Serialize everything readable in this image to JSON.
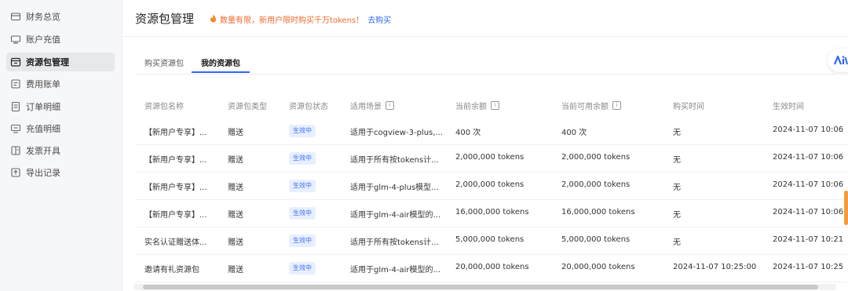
{
  "sidebar": {
    "items": [
      {
        "label": "财务总览",
        "icon": "wallet-icon",
        "active": false
      },
      {
        "label": "账户充值",
        "icon": "card-icon",
        "active": false
      },
      {
        "label": "资源包管理",
        "icon": "package-icon",
        "active": true
      },
      {
        "label": "费用账单",
        "icon": "bill-icon",
        "active": false
      },
      {
        "label": "订单明细",
        "icon": "order-icon",
        "active": false
      },
      {
        "label": "充值明细",
        "icon": "recharge-icon",
        "active": false
      },
      {
        "label": "发票开具",
        "icon": "invoice-icon",
        "active": false
      },
      {
        "label": "导出记录",
        "icon": "export-icon",
        "active": false
      }
    ]
  },
  "header": {
    "title": "资源包管理",
    "notice_text": "数量有限，新用户限时购买千万tokens！",
    "notice_link": "去购买",
    "notice_color": "#ef6b2e",
    "link_color": "#2f67f6"
  },
  "tabs": [
    {
      "label": "购买资源包",
      "active": false
    },
    {
      "label": "我的资源包",
      "active": true
    }
  ],
  "table": {
    "columns": [
      "资源包名称",
      "资源包类型",
      "资源包状态",
      "适用场景",
      "当前余额",
      "当前可用余额",
      "购买时间",
      "生效时间"
    ],
    "rows": [
      {
        "name": "【新用户专享】...",
        "type": "赠送",
        "status": "生效中",
        "scene": "适用于cogview-3-plus,...",
        "balance": "400 次",
        "available": "400 次",
        "purchase": "无",
        "effective": "2024-11-07 10:06"
      },
      {
        "name": "【新用户专享】...",
        "type": "赠送",
        "status": "生效中",
        "scene": "适用于所有按tokens计...",
        "balance": "2,000,000 tokens",
        "available": "2,000,000 tokens",
        "purchase": "无",
        "effective": "2024-11-07 10:06"
      },
      {
        "name": "【新用户专享】...",
        "type": "赠送",
        "status": "生效中",
        "scene": "适用于glm-4-plus模型...",
        "balance": "2,000,000 tokens",
        "available": "2,000,000 tokens",
        "purchase": "无",
        "effective": "2024-11-07 10:06"
      },
      {
        "name": "【新用户专享】...",
        "type": "赠送",
        "status": "生效中",
        "scene": "适用于glm-4-air模型的...",
        "balance": "16,000,000 tokens",
        "available": "16,000,000 tokens",
        "purchase": "无",
        "effective": "2024-11-07 10:06"
      },
      {
        "name": "实名认证赠送体...",
        "type": "赠送",
        "status": "生效中",
        "scene": "适用于所有按tokens计...",
        "balance": "5,000,000 tokens",
        "available": "5,000,000 tokens",
        "purchase": "无",
        "effective": "2024-11-07 10:21"
      },
      {
        "name": "邀请有礼资源包",
        "type": "赠送",
        "status": "生效中",
        "scene": "适用于glm-4-air模型的...",
        "balance": "20,000,000 tokens",
        "available": "20,000,000 tokens",
        "purchase": "2024-11-07 10:25:00",
        "effective": "2024-11-07 10:25"
      }
    ]
  },
  "fab_icon": "assistant-logo-icon"
}
